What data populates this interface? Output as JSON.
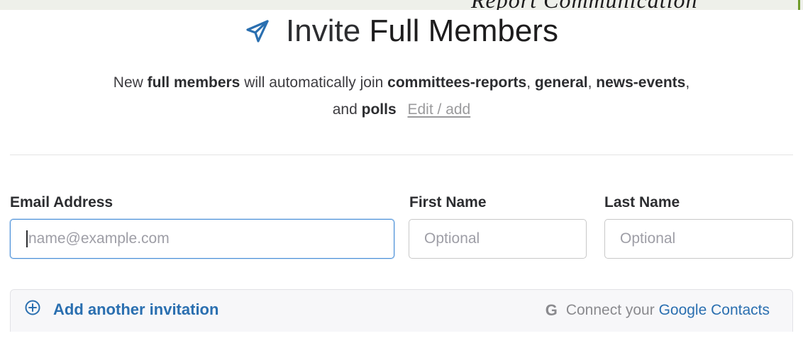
{
  "background": {
    "cut_text": "Report Communication"
  },
  "header": {
    "icon": "paper-plane-icon",
    "title_light": "Invite",
    "title_bold": "Full Members"
  },
  "description": {
    "intro": "New",
    "member_type": "full members",
    "middle": "will automatically join",
    "channel_1": "committees-reports",
    "sep_1": ",",
    "channel_2": "general",
    "sep_2": ",",
    "channel_3": "news-events",
    "sep_3": ",",
    "and": "and",
    "channel_4": "polls",
    "edit_link": "Edit / add"
  },
  "form": {
    "email": {
      "label": "Email Address",
      "placeholder": "name@example.com",
      "value": ""
    },
    "first_name": {
      "label": "First Name",
      "placeholder": "Optional",
      "value": ""
    },
    "last_name": {
      "label": "Last Name",
      "placeholder": "Optional",
      "value": ""
    }
  },
  "footer": {
    "add_icon": "plus-circle-icon",
    "add_label": "Add another invitation",
    "google_icon": "google-g-icon",
    "google_letter": "G",
    "connect_text": "Connect your",
    "google_contacts_link": "Google Contacts"
  },
  "colors": {
    "accent_blue": "#2a6fb0",
    "focus_blue": "#4a90d9",
    "text_dark": "#1d1c1d",
    "muted": "#9a9a9c"
  }
}
